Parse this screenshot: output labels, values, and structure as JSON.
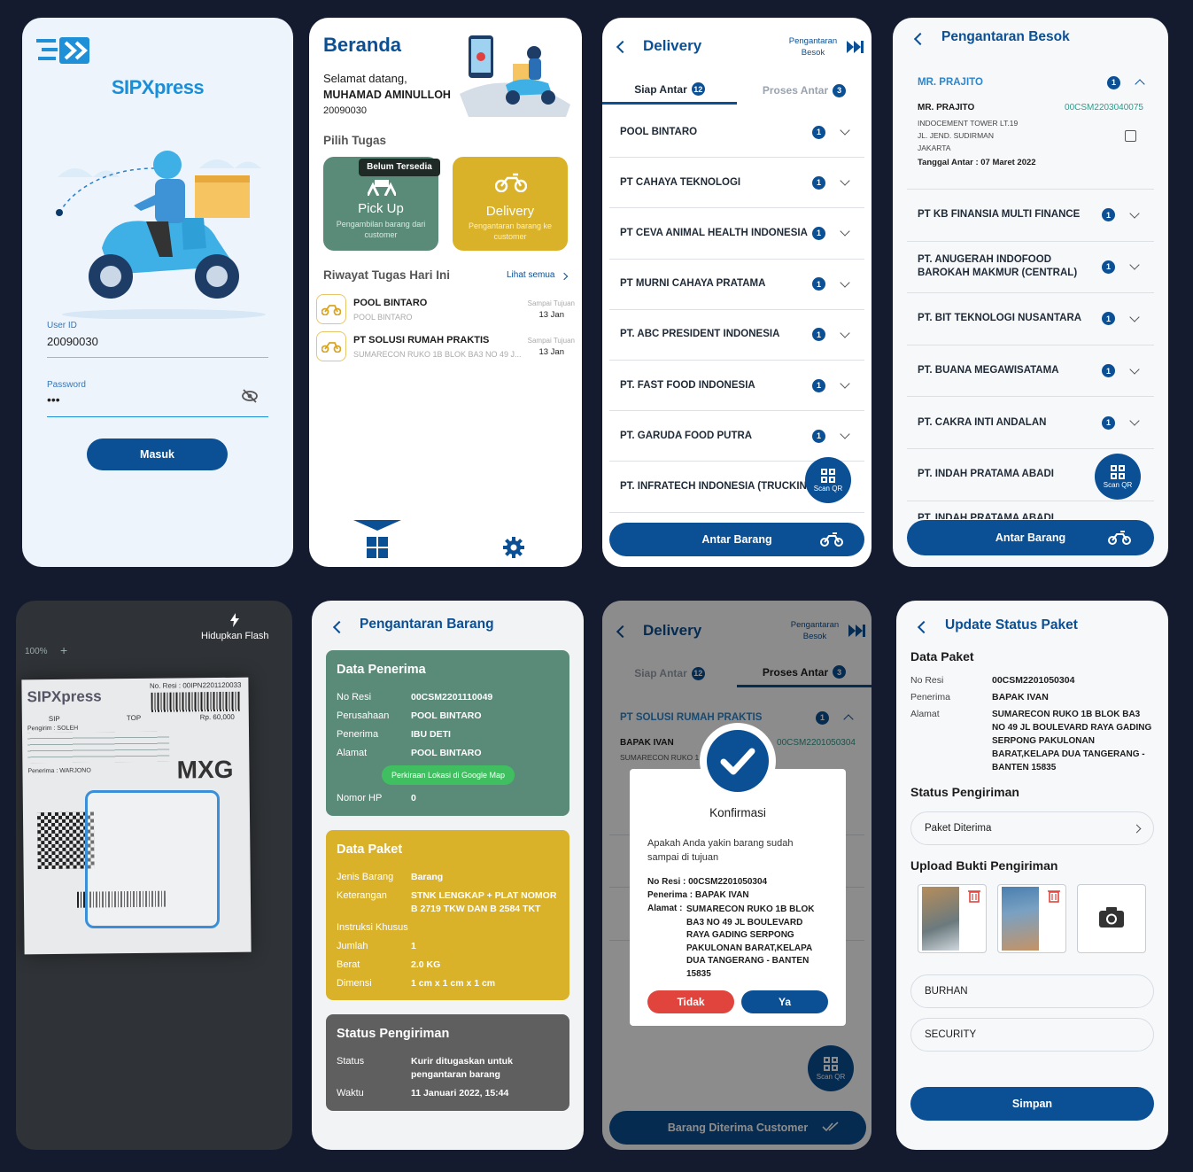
{
  "login": {
    "brand": "SIPXpress",
    "userid_label": "User ID",
    "userid_value": "20090030",
    "password_label": "Password",
    "password_value": "•••",
    "submit": "Masuk"
  },
  "home": {
    "title": "Beranda",
    "greeting": "Selamat datang,",
    "name": "MUHAMAD AMINULLOH",
    "id": "20090030",
    "section": "Pilih Tugas",
    "pickup": {
      "badge": "Belum Tersedia",
      "title": "Pick Up",
      "desc": "Pengambilan barang dari customer"
    },
    "delivery": {
      "title": "Delivery",
      "desc": "Pengantaran barang ke customer"
    },
    "history_title": "Riwayat Tugas Hari Ini",
    "see_all": "Lihat semua",
    "history": [
      {
        "name": "POOL BINTARO",
        "sub": "POOL BINTARO",
        "date_label": "Sampai Tujuan",
        "date": "13 Jan"
      },
      {
        "name": "PT SOLUSI RUMAH PRAKTIS",
        "sub": "SUMARECON RUKO 1B BLOK BA3 NO 49 J...",
        "date_label": "Sampai Tujuan",
        "date": "13 Jan"
      }
    ]
  },
  "delivery": {
    "title": "Delivery",
    "tomorrow": "Pengantaran Besok",
    "tab1": "Siap Antar",
    "tab1_count": "12",
    "tab2": "Proses Antar",
    "tab2_count": "3",
    "items": [
      {
        "name": "POOL BINTARO",
        "count": "1"
      },
      {
        "name": "PT CAHAYA TEKNOLOGI",
        "count": "1"
      },
      {
        "name": "PT CEVA ANIMAL HEALTH INDONESIA",
        "count": "1"
      },
      {
        "name": "PT MURNI CAHAYA PRATAMA",
        "count": "1"
      },
      {
        "name": "PT. ABC PRESIDENT INDONESIA",
        "count": "1"
      },
      {
        "name": "PT. FAST FOOD INDONESIA",
        "count": "1"
      },
      {
        "name": "PT. GARUDA FOOD PUTRA",
        "count": "1"
      },
      {
        "name": "PT. INFRATECH INDONESIA (TRUCKING)",
        "count": ""
      }
    ],
    "scan": "Scan QR",
    "cta": "Antar Barang"
  },
  "besok": {
    "title": "Pengantaran Besok",
    "head": "MR. PRAJITO",
    "head_count": "1",
    "detail_name": "MR. PRAJITO",
    "detail_id": "00CSM2203040075",
    "addr1": "INDOCEMENT TOWER LT.19",
    "addr2": "JL. JEND. SUDIRMAN",
    "addr3": "JAKARTA",
    "date": "Tanggal Antar : 07 Maret 2022",
    "items": [
      {
        "name": "PT KB FINANSIA MULTI FINANCE",
        "count": "1"
      },
      {
        "name": "PT. ANUGERAH INDOFOOD BAROKAH MAKMUR (CENTRAL)",
        "count": "1"
      },
      {
        "name": "PT. BIT TEKNOLOGI NUSANTARA",
        "count": "1"
      },
      {
        "name": "PT. BUANA MEGAWISATAMA",
        "count": "1"
      },
      {
        "name": "PT. CAKRA INTI ANDALAN",
        "count": "1"
      },
      {
        "name": "PT. INDAH PRATAMA ABADI",
        "count": ""
      },
      {
        "name": "PT. INDAH PRATAMA ABADI",
        "count": ""
      }
    ],
    "scan": "Scan QR",
    "cta": "Antar Barang"
  },
  "scanner": {
    "flash": "Hidupkan Flash",
    "zoom": "100%",
    "label_brand": "SIPXpress",
    "resi": "No. Resi : 00IPN2201120033",
    "price": "Rp. 60,000",
    "code": "MXG",
    "sender": "Pengirim : SOLEH",
    "receiver": "Penerima : WARJONO",
    "service": "SIP",
    "type": "TOP"
  },
  "detail": {
    "title": "Pengantaran Barang",
    "recv_title": "Data Penerima",
    "recv": [
      {
        "k": "No Resi",
        "v": "00CSM2201110049"
      },
      {
        "k": "Perusahaan",
        "v": "POOL BINTARO"
      },
      {
        "k": "Penerima",
        "v": "IBU DETI"
      },
      {
        "k": "Alamat",
        "v": "POOL BINTARO"
      }
    ],
    "map_btn": "Perkiraan Lokasi di Google Map",
    "phone_k": "Nomor HP",
    "phone_v": "0",
    "pkg_title": "Data Paket",
    "pkg": [
      {
        "k": "Jenis Barang",
        "v": "Barang"
      },
      {
        "k": "Keterangan",
        "v": "STNK LENGKAP + PLAT NOMOR B 2719 TKW DAN B 2584 TKT"
      },
      {
        "k": "Instruksi Khusus",
        "v": ""
      },
      {
        "k": "Jumlah",
        "v": "1"
      },
      {
        "k": "Berat",
        "v": "2.0 KG"
      },
      {
        "k": "Dimensi",
        "v": "1 cm x 1 cm x 1 cm"
      }
    ],
    "status_title": "Status Pengiriman",
    "status_k": "Status",
    "status_v": "Kurir ditugaskan untuk pengantaran barang",
    "time_k": "Waktu",
    "time_v": "11 Januari 2022, 15:44"
  },
  "confirm": {
    "title": "Delivery",
    "tomorrow": "Pengantaran Besok",
    "tab1": "Siap Antar",
    "tab1_count": "12",
    "tab2": "Proses Antar",
    "tab2_count": "3",
    "group": "PT SOLUSI RUMAH PRAKTIS",
    "group_count": "1",
    "bg_name": "BAPAK IVAN",
    "bg_id": "00CSM2201050304",
    "bg_addr": "SUMARECON RUKO 1",
    "dialog_title": "Konfirmasi",
    "question": "Apakah Anda yakin barang sudah sampai di tujuan",
    "resi": "No Resi : 00CSM2201050304",
    "penerima": "Penerima : BAPAK IVAN",
    "alamat_k": "Alamat :",
    "alamat_v": "SUMARECON RUKO 1B BLOK BA3 NO 49 JL BOULEVARD RAYA GADING SERPONG PAKULONAN BARAT,KELAPA DUA TANGERANG - BANTEN 15835",
    "no": "Tidak",
    "yes": "Ya",
    "scan": "Scan QR",
    "cta": "Barang Diterima Customer"
  },
  "update": {
    "title": "Update Status Paket",
    "data_title": "Data Paket",
    "resi_k": "No Resi",
    "resi_v": "00CSM2201050304",
    "penerima_k": "Penerima",
    "penerima_v": "BAPAK IVAN",
    "alamat_k": "Alamat",
    "alamat_v": "SUMARECON RUKO 1B BLOK BA3 NO 49 JL BOULEVARD RAYA GADING SERPONG PAKULONAN BARAT,KELAPA DUA TANGERANG - BANTEN 15835",
    "status_title": "Status Pengiriman",
    "status_value": "Paket Diterima",
    "upload_title": "Upload Bukti Pengiriman",
    "receiver_name": "BURHAN",
    "receiver_role": "SECURITY",
    "save": "Simpan"
  },
  "colors": {
    "navy": "#0b4f94",
    "teal": "#5a8a78",
    "yellow": "#d9b22a",
    "grey": "#5f5f5f",
    "red": "#e0443c",
    "cyan": "#2aa6e0",
    "bg": "#141b2e"
  }
}
